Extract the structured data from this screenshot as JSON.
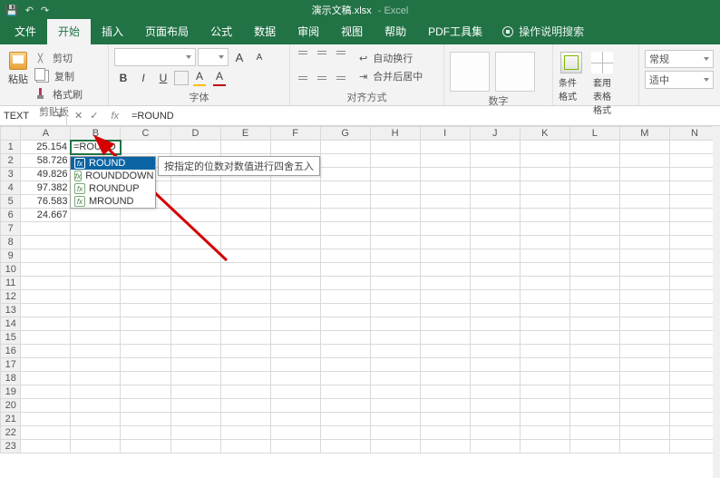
{
  "titlebar": {
    "filename": "演示文稿.xlsx",
    "app": "- Excel"
  },
  "tabs": {
    "file": "文件",
    "home": "开始",
    "insert": "插入",
    "layout": "页面布局",
    "formulas": "公式",
    "data": "数据",
    "review": "审阅",
    "view": "视图",
    "help": "帮助",
    "pdf": "PDF工具集",
    "tellme": "操作说明搜索"
  },
  "ribbon": {
    "clipboard": {
      "paste": "粘贴",
      "cut": "剪切",
      "copy": "复制",
      "brush": "格式刷",
      "group": "剪贴板"
    },
    "font": {
      "bold": "B",
      "italic": "I",
      "underline": "U",
      "group": "字体",
      "grow": "A",
      "shrink": "A"
    },
    "align": {
      "wrap": "自动换行",
      "merge": "合并后居中",
      "group": "对齐方式"
    },
    "number": {
      "general": "常规",
      "currency": "适中",
      "group": "数字"
    },
    "styles": {
      "cond": "条件格式",
      "table": "套用\n表格格式"
    }
  },
  "addr": {
    "name": "TEXT",
    "formula": "=ROUND"
  },
  "columns": [
    "A",
    "B",
    "C",
    "D",
    "E",
    "F",
    "G",
    "H",
    "I",
    "J",
    "K",
    "L",
    "M",
    "N"
  ],
  "rows": [
    "1",
    "2",
    "3",
    "4",
    "5",
    "6",
    "7",
    "8",
    "9",
    "10",
    "11",
    "12",
    "13",
    "14",
    "15",
    "16",
    "17",
    "18",
    "19",
    "20",
    "21",
    "22",
    "23"
  ],
  "colA": [
    "25.154",
    "58.726",
    "49.826",
    "97.382",
    "76.583",
    "24.667"
  ],
  "editing_cell": "=ROUND",
  "autocomplete": {
    "items": [
      "ROUND",
      "ROUNDDOWN",
      "ROUNDUP",
      "MROUND"
    ],
    "selected_index": 0,
    "tip": "按指定的位数对数值进行四舍五入"
  }
}
